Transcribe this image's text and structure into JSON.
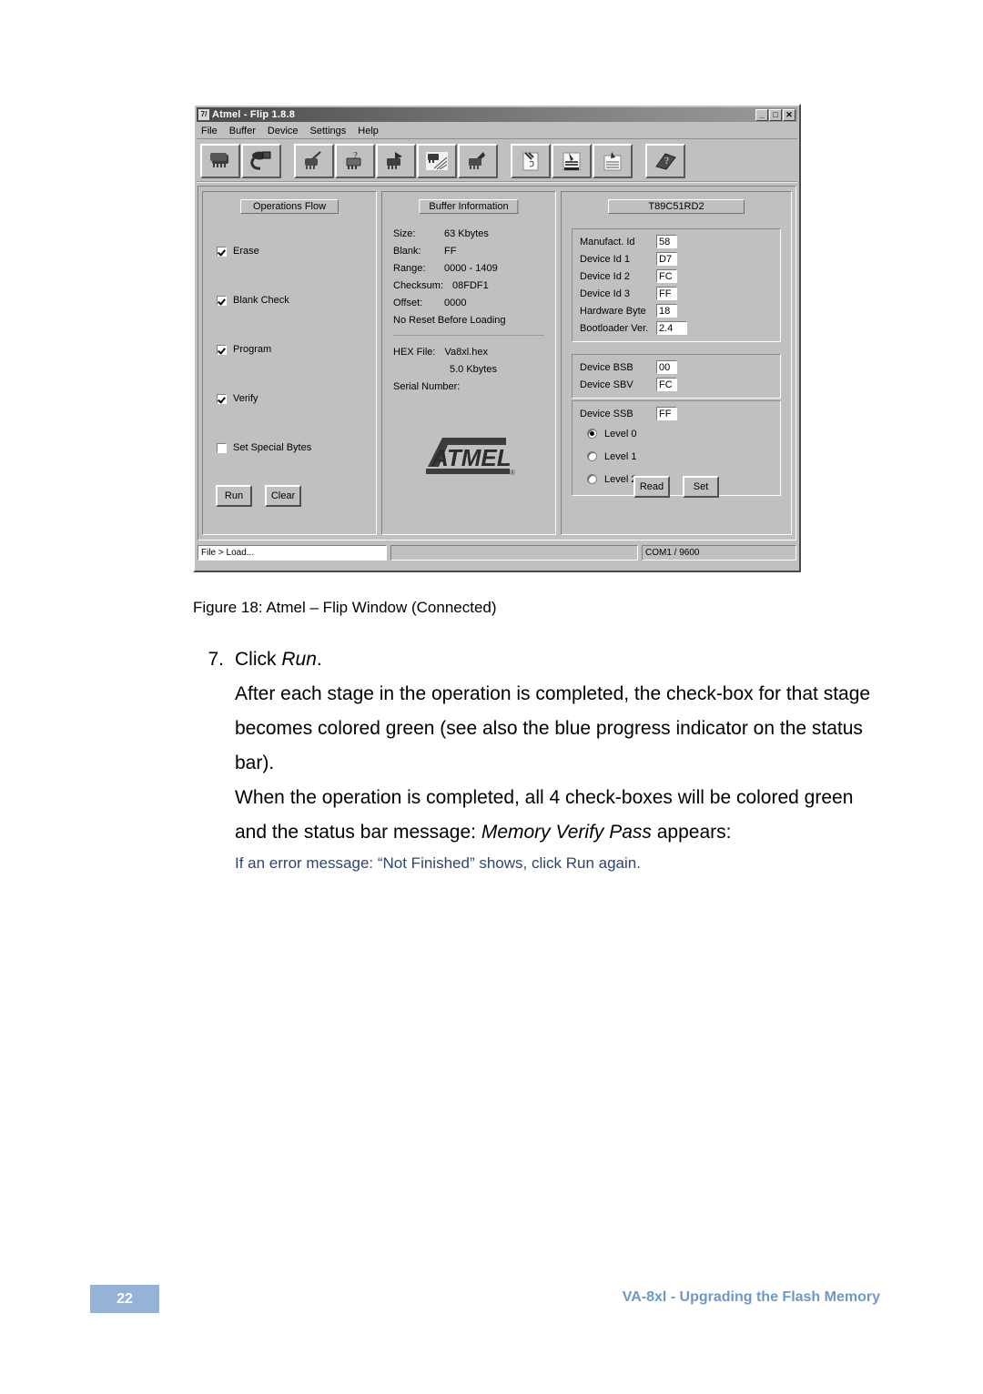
{
  "window": {
    "title": "Atmel - Flip 1.8.8",
    "title_icon": "atmel-app-icon",
    "controls": {
      "minimize": "_",
      "maximize": "□",
      "close": "✕"
    },
    "menus": [
      "File",
      "Buffer",
      "Device",
      "Settings",
      "Help"
    ],
    "toolbar_groups": [
      {
        "buttons": [
          {
            "name": "select-device-icon",
            "icon": "chip"
          },
          {
            "name": "communication-settings-icon",
            "icon": "cable"
          }
        ]
      },
      {
        "buttons": [
          {
            "name": "erase-icon",
            "icon": "chip-erase"
          },
          {
            "name": "blank-check-icon",
            "icon": "chip-question"
          },
          {
            "name": "program-icon",
            "icon": "chip-program"
          },
          {
            "name": "verify-icon",
            "icon": "chip-verify"
          },
          {
            "name": "read-icon",
            "icon": "chip-read"
          }
        ]
      },
      {
        "buttons": [
          {
            "name": "new-file-icon",
            "icon": "page-new"
          },
          {
            "name": "load-file-icon",
            "icon": "page-load"
          },
          {
            "name": "save-file-icon",
            "icon": "page-save"
          }
        ]
      },
      {
        "buttons": [
          {
            "name": "help-icon",
            "icon": "book-question"
          }
        ]
      }
    ]
  },
  "operations_flow": {
    "title": "Operations Flow",
    "items": [
      {
        "label": "Erase",
        "checked": true
      },
      {
        "label": "Blank Check",
        "checked": true
      },
      {
        "label": "Program",
        "checked": true
      },
      {
        "label": "Verify",
        "checked": true
      },
      {
        "label": "Set Special Bytes",
        "checked": false
      }
    ],
    "run_label": "Run",
    "clear_label": "Clear"
  },
  "buffer_information": {
    "title": "Buffer Information",
    "rows": [
      {
        "key": "Size:",
        "value": "63 Kbytes"
      },
      {
        "key": "Blank:",
        "value": "FF"
      },
      {
        "key": "Range:",
        "value": "0000 - 1409"
      },
      {
        "key": "Checksum:",
        "value": "08FDF1"
      },
      {
        "key": "Offset:",
        "value": "0000"
      }
    ],
    "note": "No Reset Before Loading",
    "hex_file_key": "HEX File:",
    "hex_file_value": "Va8xl.hex",
    "hex_file_size": "5.0 Kbytes",
    "serial_number_key": "Serial Number:",
    "logo": "ATMEL"
  },
  "device": {
    "title": "T89C51RD2",
    "id_rows": [
      {
        "label": "Manufact. Id",
        "value": "58"
      },
      {
        "label": "Device Id 1",
        "value": "D7"
      },
      {
        "label": "Device Id 2",
        "value": "FC"
      },
      {
        "label": "Device Id 3",
        "value": "FF"
      },
      {
        "label": "Hardware Byte",
        "value": "18"
      },
      {
        "label": "Bootloader Ver.",
        "value": "2.4"
      }
    ],
    "byte_rows": [
      {
        "label": "Device BSB",
        "value": "00"
      },
      {
        "label": "Device SBV",
        "value": "FC"
      }
    ],
    "ssb_label": "Device SSB",
    "ssb_value": "FF",
    "levels": [
      {
        "label": "Level 0",
        "selected": true
      },
      {
        "label": "Level 1",
        "selected": false
      },
      {
        "label": "Level 2",
        "selected": false
      }
    ],
    "read_label": "Read",
    "set_label": "Set"
  },
  "status_bar": {
    "message": "File > Load...",
    "progress_percent": 0,
    "connection": "COM1 / 9600"
  },
  "document": {
    "figure_caption": "Figure 18: Atmel – Flip Window (Connected)",
    "step_number": "7.",
    "step_prefix": "Click ",
    "step_emphasis": "Run",
    "step_suffix": ".",
    "paragraph1": "After each stage in the operation is completed, the check-box for that stage becomes colored green (see also the blue progress indicator on the status bar).",
    "paragraph2_prefix": "When the operation is completed, all 4 check-boxes will be colored green and the status bar message: ",
    "paragraph2_emphasis": "Memory Verify Pass",
    "paragraph2_suffix": " appears:",
    "blue_note": "If an error message: “Not Finished” shows, click Run again."
  },
  "footer": {
    "page_number": "22",
    "title": "VA-8xl - Upgrading the Flash Memory",
    "page_box_color": "#94b3d7",
    "title_color": "#6e98c8"
  }
}
